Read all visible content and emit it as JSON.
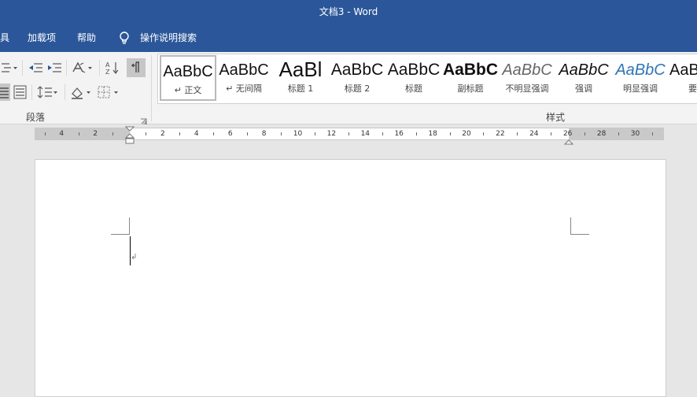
{
  "title_bar": {
    "title": "文档3  -  Word"
  },
  "tabs": [
    {
      "label": "具"
    },
    {
      "label": "加载项"
    },
    {
      "label": "帮助"
    },
    {
      "label": "操作说明搜索"
    }
  ],
  "tellme_icon": "lightbulb-icon",
  "ribbon": {
    "paragraph_group_label": "段落",
    "styles_group_label": "样式",
    "styles": [
      {
        "preview": "AaBbC",
        "caption": "↵ 正文"
      },
      {
        "preview": "AaBbC",
        "caption": "↵ 无间隔"
      },
      {
        "preview": "AaBl",
        "caption": "标题 1"
      },
      {
        "preview": "AaBbC",
        "caption": "标题 2"
      },
      {
        "preview": "AaBbC",
        "caption": "标题"
      },
      {
        "preview": "AaBbC",
        "caption": "副标题"
      },
      {
        "preview": "AaBbC",
        "caption": "不明显强调"
      },
      {
        "preview": "AaBbC",
        "caption": "强调"
      },
      {
        "preview": "AaBbC",
        "caption": "明显强调"
      },
      {
        "preview": "AaB",
        "caption": "要"
      }
    ]
  },
  "ruler": {
    "labels": [
      "4",
      "2",
      "2",
      "4",
      "6",
      "8",
      "10",
      "12",
      "14",
      "16",
      "18",
      "20",
      "22",
      "24",
      "26",
      "28",
      "30"
    ]
  },
  "colors": {
    "accent": "#2b579a",
    "ribbon_bg": "#f3f3f3",
    "workspace_bg": "#e6e6e6"
  }
}
